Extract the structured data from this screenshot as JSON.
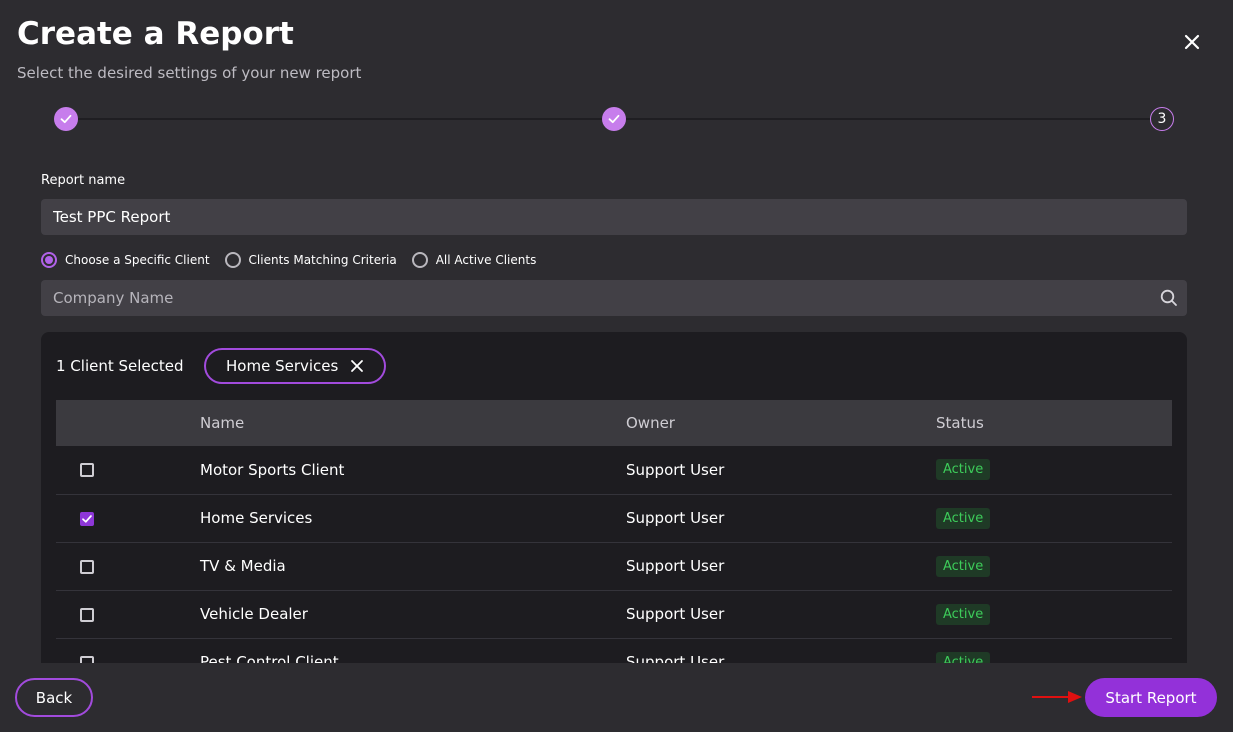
{
  "dialog": {
    "title": "Create a Report",
    "subtitle": "Select the desired settings of your new report"
  },
  "stepper": {
    "steps": [
      {
        "state": "done"
      },
      {
        "state": "done"
      },
      {
        "state": "current",
        "label": "3"
      }
    ]
  },
  "report_name": {
    "label": "Report name",
    "value": "Test PPC Report"
  },
  "client_mode": {
    "options": [
      {
        "label": "Choose a Specific Client",
        "checked": true
      },
      {
        "label": "Clients Matching Criteria",
        "checked": false
      },
      {
        "label": "All Active Clients",
        "checked": false
      }
    ]
  },
  "search": {
    "placeholder": "Company Name",
    "icon": "search-icon"
  },
  "selection": {
    "summary": "1 Client Selected",
    "chips": [
      {
        "label": "Home Services"
      }
    ]
  },
  "table": {
    "headers": {
      "name": "Name",
      "owner": "Owner",
      "status": "Status"
    },
    "rows": [
      {
        "name": "Motor Sports Client",
        "owner": "Support User",
        "status": "Active",
        "checked": false
      },
      {
        "name": "Home Services",
        "owner": "Support User",
        "status": "Active",
        "checked": true
      },
      {
        "name": "TV & Media",
        "owner": "Support User",
        "status": "Active",
        "checked": false
      },
      {
        "name": "Vehicle Dealer",
        "owner": "Support User",
        "status": "Active",
        "checked": false
      },
      {
        "name": "Pest Control Client",
        "owner": "Support User",
        "status": "Active",
        "checked": false
      }
    ]
  },
  "footer": {
    "back_label": "Back",
    "start_label": "Start Report"
  },
  "colors": {
    "accent": "#9331d9",
    "step_done": "#c77dec",
    "status_active": "#3dcc5a",
    "annotation_arrow": "#e01010"
  }
}
